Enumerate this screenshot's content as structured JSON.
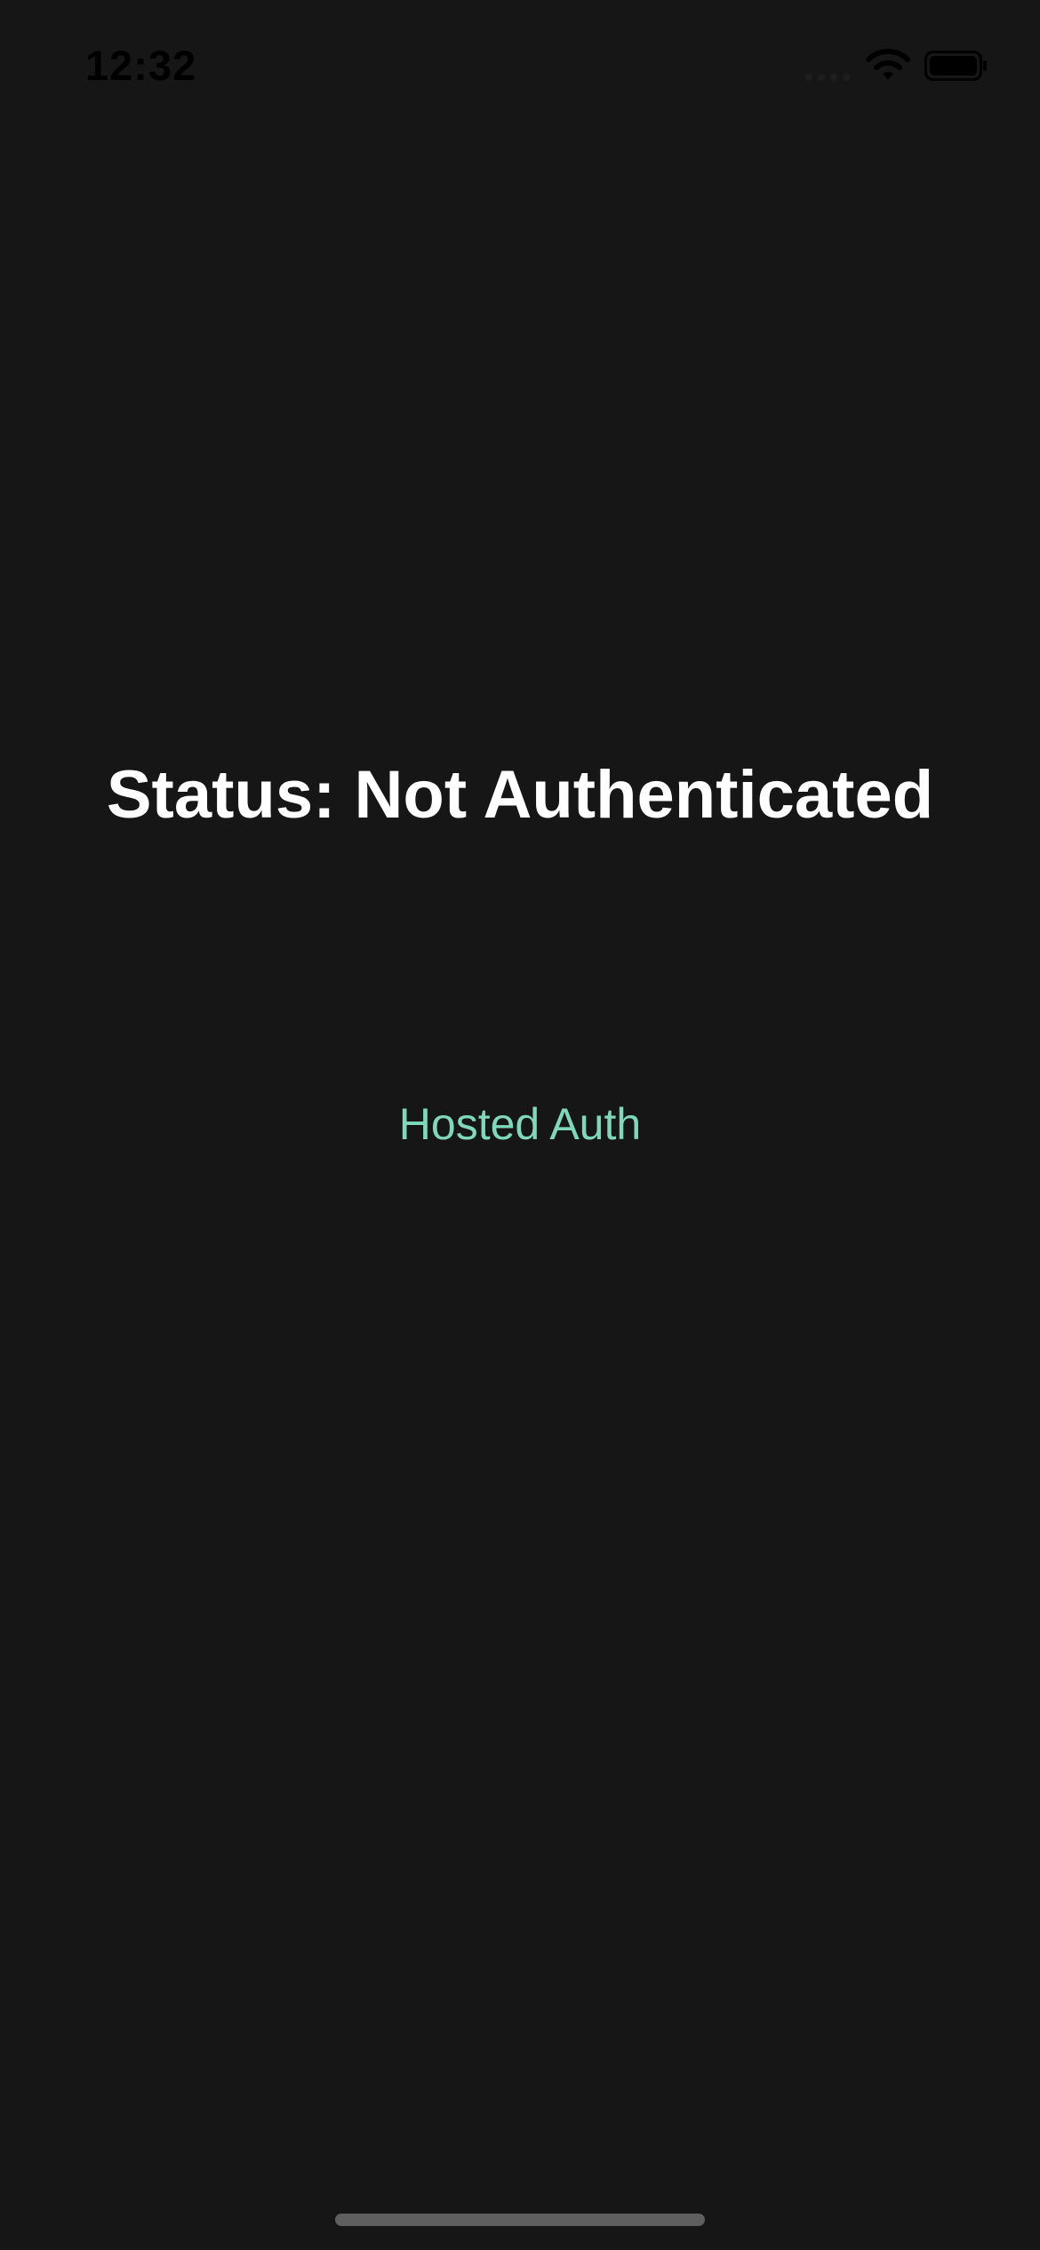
{
  "status_bar": {
    "time": "12:32",
    "icons": [
      "signal-icon",
      "wifi-icon",
      "battery-icon"
    ]
  },
  "main": {
    "status_text": "Status: Not Authenticated",
    "hosted_auth_label": "Hosted Auth"
  },
  "colors": {
    "background": "#161616",
    "primary_text": "#ffffff",
    "accent": "#7fd8b9"
  }
}
